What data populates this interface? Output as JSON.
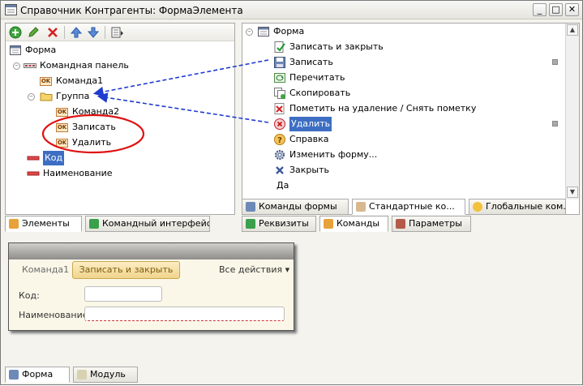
{
  "window": {
    "title": "Справочник Контрагенты: ФормаЭлемента",
    "buttons": {
      "minimize": "_",
      "maximize": "□",
      "close": "✕"
    }
  },
  "left_panel": {
    "toolbar_icons": [
      "add-icon",
      "edit-icon",
      "delete-icon",
      "move-up-icon",
      "move-down-icon",
      "properties-icon"
    ],
    "tree": {
      "root": "Форма",
      "command_panel": "Командная панель",
      "command1": "Команда1",
      "group": "Группа",
      "command2": "Команда2",
      "write": "Записать",
      "delete": "Удалить",
      "code": "Код",
      "name": "Наименование"
    },
    "tabs": {
      "elements": "Элементы",
      "command_interface": "Командный интерфейс"
    }
  },
  "right_panel": {
    "tree": {
      "root": "Форма",
      "items": [
        "Записать и закрыть",
        "Записать",
        "Перечитать",
        "Скопировать",
        "Пометить на удаление / Снять пометку",
        "Удалить",
        "Справка",
        "Изменить форму...",
        "Закрыть",
        "Да"
      ]
    },
    "tabs_upper": {
      "form_commands": "Команды формы",
      "standard_commands": "Стандартные ко...",
      "global_commands": "Глобальные ком..."
    },
    "tabs_lower": {
      "attributes": "Реквизиты",
      "commands": "Команды",
      "parameters": "Параметры"
    }
  },
  "preview": {
    "command1": "Команда1",
    "save_close": "Записать и закрыть",
    "all_actions": "Все действия ▾",
    "code_label": "Код:",
    "code_value": "",
    "name_label": "Наименование:",
    "name_value": ""
  },
  "bottom_tabs": {
    "form": "Форма",
    "module": "Модуль"
  },
  "colors": {
    "selection": "#3d6ec3",
    "annotation_arrow": "#1f3bd0",
    "annotation_circle": "#e01010",
    "preview_button": "#f0d48b"
  }
}
